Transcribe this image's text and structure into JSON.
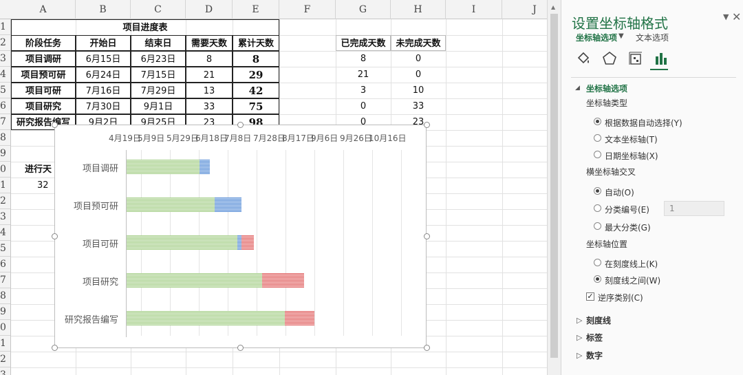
{
  "sheet": {
    "columns": [
      "A",
      "B",
      "C",
      "D",
      "E",
      "F",
      "G",
      "H",
      "I",
      "J"
    ],
    "rows": [
      "1",
      "2",
      "3",
      "4",
      "5",
      "6",
      "7",
      "8",
      "9",
      "0",
      "1",
      "2",
      "3",
      "4",
      "5",
      "6",
      "7",
      "8",
      "9",
      "0",
      "1",
      "2",
      "3",
      "4"
    ],
    "table_title": "项目进度表",
    "headers": [
      "阶段任务",
      "开始日",
      "结束日",
      "需要天数",
      "累计天数"
    ],
    "side_headers": [
      "已完成天数",
      "未完成天数"
    ],
    "table_rows": [
      {
        "task": "项目调研",
        "start": "6月15日",
        "end": "6月23日",
        "need": "8",
        "cum": "8",
        "done": "8",
        "remain": "0"
      },
      {
        "task": "项目预可研",
        "start": "6月24日",
        "end": "7月15日",
        "need": "21",
        "cum": "29",
        "done": "21",
        "remain": "0"
      },
      {
        "task": "项目可研",
        "start": "7月16日",
        "end": "7月29日",
        "need": "13",
        "cum": "42",
        "done": "3",
        "remain": "10"
      },
      {
        "task": "项目研究",
        "start": "7月30日",
        "end": "9月1日",
        "need": "33",
        "cum": "75",
        "done": "0",
        "remain": "33"
      },
      {
        "task": "研究报告编写",
        "start": "9月2日",
        "end": "9月25日",
        "need": "23",
        "cum": "98",
        "done": "0",
        "remain": "23"
      }
    ],
    "progress_label": "进行天",
    "progress_value": "32"
  },
  "chart_data": {
    "type": "bar",
    "orientation": "horizontal-stacked",
    "x_tick_labels": [
      "4月19日",
      "5月9日",
      "5月29日",
      "6月18日",
      "7月8日",
      "7月28日",
      "8月17日",
      "9月6日",
      "9月26日",
      "10月16日"
    ],
    "categories": [
      "项目调研",
      "项目预可研",
      "项目可研",
      "项目研究",
      "研究报告编写"
    ],
    "x_axis_position": "top",
    "grid": true,
    "series": [
      {
        "values": [
          57,
          69,
          87,
          106,
          124
        ],
        "color": "#a9d18e"
      },
      {
        "values": [
          8,
          21,
          3,
          0,
          0
        ],
        "color": "#5b8fd6"
      },
      {
        "values": [
          0,
          0,
          10,
          33,
          23
        ],
        "color": "#e06666"
      }
    ]
  },
  "pane": {
    "title": "设置坐标轴格式",
    "tab_axis": "坐标轴选项",
    "tab_text": "文本选项",
    "section_axis": "坐标轴选项",
    "axis_type_label": "坐标轴类型",
    "axis_type_options": [
      "根据数据自动选择(Y)",
      "文本坐标轴(T)",
      "日期坐标轴(X)"
    ],
    "cross_label": "横坐标轴交叉",
    "cross_options": [
      "自动(O)",
      "分类编号(E)",
      "最大分类(G)"
    ],
    "cross_value": "1",
    "position_label": "坐标轴位置",
    "position_options": [
      "在刻度线上(K)",
      "刻度线之间(W)"
    ],
    "reverse_label": "逆序类别(C)",
    "collapsed_sections": [
      "刻度线",
      "标签",
      "数字"
    ],
    "accent_color": "#217346"
  }
}
